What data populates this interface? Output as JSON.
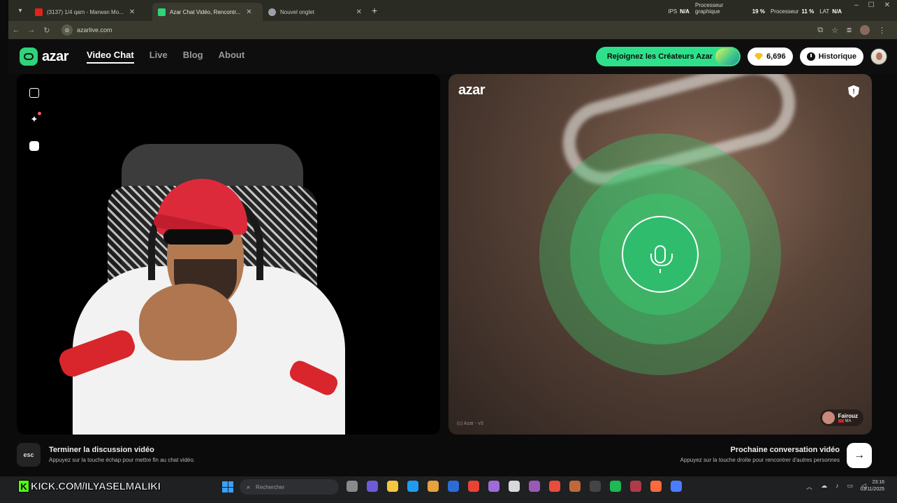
{
  "browser": {
    "tabs": [
      {
        "title": "(3137) 1/4 qam - Marwan Mo...",
        "favicon_color": "#e62117"
      },
      {
        "title": "Azar Chat Vidéo, Rencontr...",
        "favicon_color": "#2fd37a",
        "active": true
      },
      {
        "title": "Nouvel onglet",
        "favicon_color": "#9aa0a6"
      }
    ],
    "url": "azarlive.com",
    "stats": {
      "ips_label": "IPS",
      "ips_value": "N/A",
      "gpu_label": "Processeur graphique",
      "gpu_value": "19 %",
      "cpu_label": "Processeur",
      "cpu_value": "11 %",
      "lat_label": "LAT",
      "lat_value": "N/A"
    }
  },
  "site": {
    "logo": "azar",
    "nav": [
      {
        "label": "Video Chat",
        "active": true
      },
      {
        "label": "Live"
      },
      {
        "label": "Blog"
      },
      {
        "label": "About"
      }
    ],
    "creator_button": "Rejoignez les Créateurs Azar",
    "gems": "6,696",
    "history_button": "Historique"
  },
  "right_panel": {
    "logo": "azar",
    "watermark": "(c) Azar - v3",
    "partner": {
      "name": "Fairouz",
      "country": "MA"
    }
  },
  "hints": {
    "esc_key": "esc",
    "end_title": "Terminer la discussion vidéo",
    "end_sub": "Appuyez sur la touche échap pour mettre fin au chat vidéo.",
    "next_title": "Prochaine conversation vidéo",
    "next_sub": "Appuyez sur la touche droite pour rencontrer d'autres personnes"
  },
  "overlay": {
    "kick_text": "KICK.COM/ILYASELMALIKI"
  },
  "taskbar": {
    "search_placeholder": "Rechercher",
    "time": "23:16",
    "date": "03/11/2025",
    "app_colors": [
      "#8a8a8a",
      "#6b5bd6",
      "#f5c542",
      "#1f9cf0",
      "#e6a23c",
      "#2b6cd9",
      "#ea4335",
      "#a06ad8",
      "#d9d9d9",
      "#9b59b6",
      "#e74c3c",
      "#c0683a",
      "#444444",
      "#1db954",
      "#b03a48",
      "#ff6a3d",
      "#4a7dff"
    ]
  }
}
